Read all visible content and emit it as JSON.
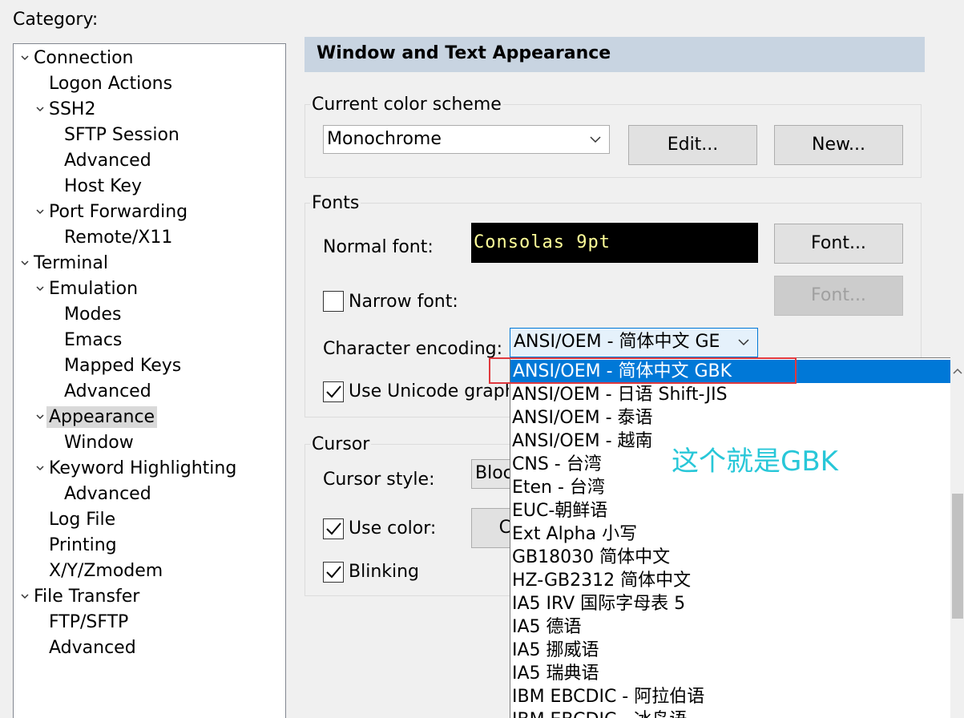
{
  "category_label": "Category:",
  "tree": [
    {
      "label": "Connection",
      "expanded": true
    },
    {
      "label": "Logon Actions"
    },
    {
      "label": "SSH2",
      "expanded": true
    },
    {
      "label": "SFTP Session"
    },
    {
      "label": "Advanced"
    },
    {
      "label": "Host Key"
    },
    {
      "label": "Port Forwarding",
      "expanded": true
    },
    {
      "label": "Remote/X11"
    },
    {
      "label": "Terminal",
      "expanded": true
    },
    {
      "label": "Emulation",
      "expanded": true
    },
    {
      "label": "Modes"
    },
    {
      "label": "Emacs"
    },
    {
      "label": "Mapped Keys"
    },
    {
      "label": "Advanced"
    },
    {
      "label": "Appearance",
      "expanded": true,
      "selected": true
    },
    {
      "label": "Window"
    },
    {
      "label": "Keyword Highlighting",
      "expanded": true
    },
    {
      "label": "Advanced"
    },
    {
      "label": "Log File"
    },
    {
      "label": "Printing"
    },
    {
      "label": "X/Y/Zmodem"
    },
    {
      "label": "File Transfer",
      "expanded": true
    },
    {
      "label": "FTP/SFTP"
    },
    {
      "label": "Advanced"
    }
  ],
  "panel": {
    "title": "Window and Text Appearance",
    "color_scheme": {
      "group_title": "Current color scheme",
      "selected": "Monochrome",
      "edit_label": "Edit...",
      "new_label": "New..."
    },
    "fonts": {
      "group_title": "Fonts",
      "normal_font_label": "Normal font:",
      "normal_font_preview": "Consolas 9pt",
      "font_button": "Font...",
      "narrow_font_label": "Narrow font:",
      "narrow_font_checked": false,
      "narrow_font_button": "Font...",
      "encoding_label": "Character encoding:",
      "encoding_selected": "ANSI/OEM - 简体中文 GE",
      "unicode_label": "Use Unicode graph",
      "unicode_checked": true
    },
    "cursor": {
      "group_title": "Cursor",
      "style_label": "Cursor style:",
      "style_value": "Bloc",
      "use_color_label": "Use color:",
      "use_color_checked": true,
      "color_button_partial": "C",
      "blinking_label": "Blinking",
      "blinking_checked": true
    }
  },
  "encoding_dropdown": {
    "items": [
      "ANSI/OEM - 简体中文 GBK",
      "ANSI/OEM - 日语 Shift-JIS",
      "ANSI/OEM - 泰语",
      "ANSI/OEM - 越南",
      "CNS - 台湾",
      "Eten - 台湾",
      "EUC-朝鲜语",
      "Ext Alpha 小写",
      "GB18030 简体中文",
      "HZ-GB2312 简体中文",
      "IA5 IRV 国际字母表 5",
      "IA5 德语",
      "IA5 挪威语",
      "IA5 瑞典语",
      "IBM EBCDIC - 阿拉伯语",
      "IBM EBCDIC - 冰岛语"
    ],
    "selected_index": 0
  },
  "annotation": "这个就是GBK",
  "colors": {
    "selection": "#0078d7",
    "header_bar": "#c8d4e1",
    "highlight_box": "#e0393e",
    "annotation": "#28c7d8"
  }
}
